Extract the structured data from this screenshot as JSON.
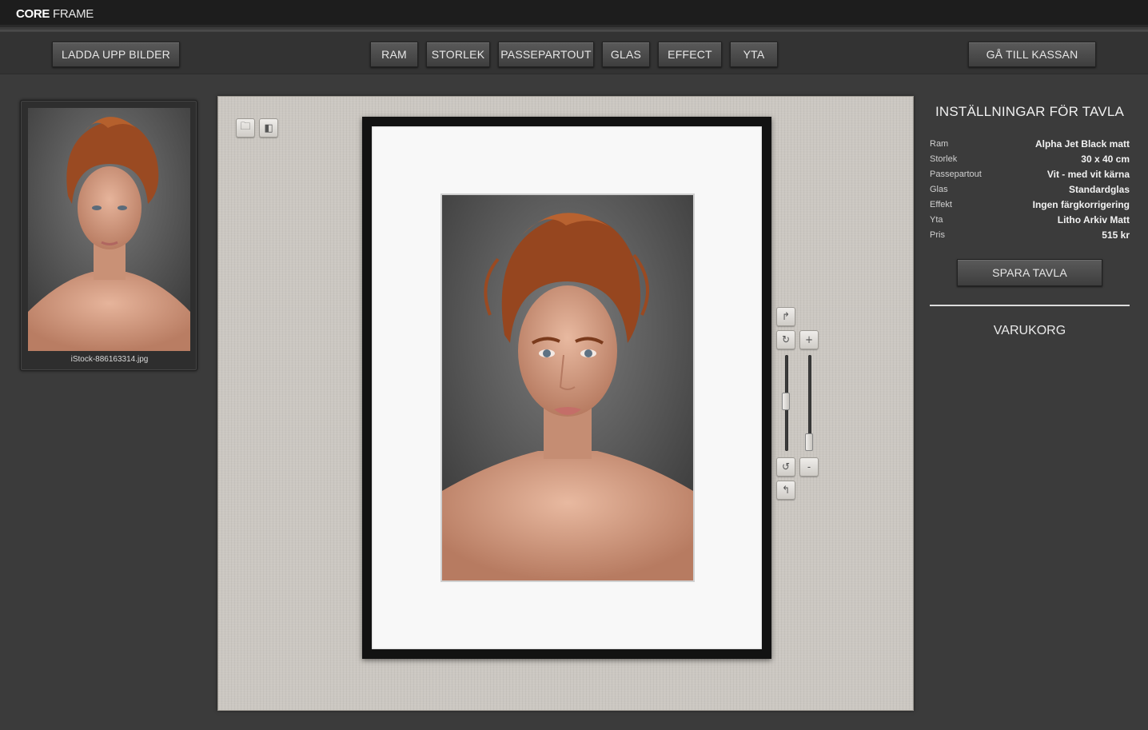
{
  "app": {
    "logo_bold": "CORE",
    "logo_light": "FRAME"
  },
  "nav": {
    "upload": "LADDA UPP BILDER",
    "tabs": [
      "RAM",
      "STORLEK",
      "PASSEPARTOUT",
      "GLAS",
      "EFFECT",
      "YTA"
    ],
    "checkout": "GÅ TILL KASSAN"
  },
  "thumbnail": {
    "filename": "iStock-886163314.jpg"
  },
  "canvas": {
    "tools": [
      {
        "icon": "folder-icon",
        "glyph": "🗀"
      },
      {
        "icon": "layout-icon",
        "glyph": "◧"
      }
    ],
    "controls": {
      "rotate_right_glyph": "↱",
      "rotate_cw_glyph": "↻",
      "zoom_in_glyph": "+",
      "rotate_ccw_glyph": "↺",
      "zoom_out_glyph": "-",
      "undo_glyph": "↰",
      "slider_left_level": 0.5,
      "slider_right_level": 0.1
    },
    "colors": {
      "frame": "#121212",
      "mat": "#f8f8f8",
      "backdrop": "#cbc7c1"
    }
  },
  "settings": {
    "title": "INSTÄLLNINGAR FÖR TAVLA",
    "rows": [
      {
        "key": "Ram",
        "value": "Alpha Jet Black matt"
      },
      {
        "key": "Storlek",
        "value": "30 x 40 cm"
      },
      {
        "key": "Passepartout",
        "value": "Vit - med vit kärna"
      },
      {
        "key": "Glas",
        "value": "Standardglas"
      },
      {
        "key": "Effekt",
        "value": "Ingen färgkorrigering"
      },
      {
        "key": "Yta",
        "value": "Litho Arkiv Matt"
      },
      {
        "key": "Pris",
        "value": "515 kr"
      }
    ],
    "save_label": "SPARA TAVLA"
  },
  "cart": {
    "title": "VARUKORG"
  }
}
